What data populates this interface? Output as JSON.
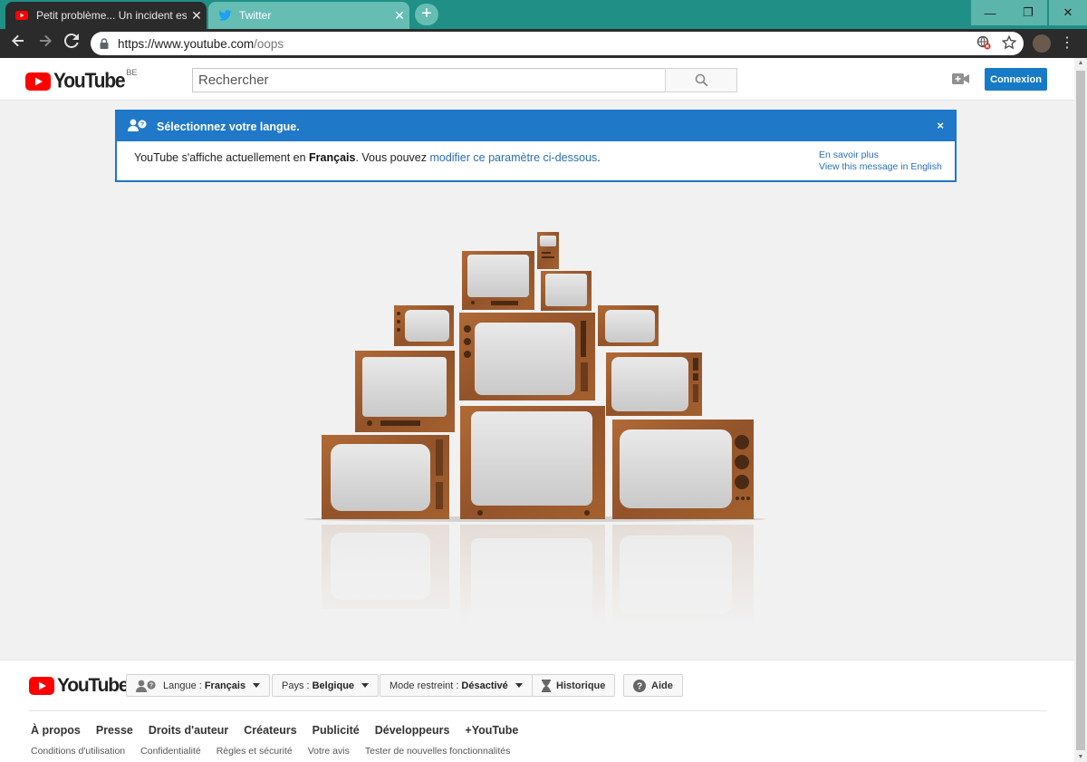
{
  "browser": {
    "tabs": [
      {
        "title": "Petit problème... Un incident est s",
        "active": true
      },
      {
        "title": "Twitter",
        "active": false
      }
    ],
    "close_glyph": "✕",
    "new_tab_glyph": "+",
    "window_controls": {
      "minimize": "—",
      "maximize": "❐",
      "close": "✕"
    },
    "url_domain": "https://www.youtube.com",
    "url_path": "/oops"
  },
  "header": {
    "logo_text": "YouTube",
    "region": "BE",
    "search_placeholder": "Rechercher",
    "signin_label": "Connexion"
  },
  "notice": {
    "title": "Sélectionnez votre langue.",
    "close": "×",
    "body_before": "YouTube s'affiche actuellement en ",
    "language": "Français",
    "body_middle": ". Vous pouvez ",
    "body_link": "modifier ce paramètre ci-dessous",
    "body_after": ".",
    "learn_more": "En savoir plus",
    "view_english": "View this message in English"
  },
  "footer": {
    "logo_text": "YouTube",
    "language": {
      "label": "Langue :",
      "value": "Français"
    },
    "country": {
      "label": "Pays :",
      "value": "Belgique"
    },
    "restricted": {
      "label": "Mode restreint :",
      "value": "Désactivé"
    },
    "history_label": "Historique",
    "help_label": "Aide",
    "primary_links": [
      "À propos",
      "Presse",
      "Droits d'auteur",
      "Créateurs",
      "Publicité",
      "Développeurs",
      "+YouTube"
    ],
    "secondary_links": [
      "Conditions d'utilisation",
      "Confidentialité",
      "Règles et sécurité",
      "Votre avis",
      "Tester de nouvelles fonctionnalités"
    ]
  },
  "colors": {
    "tabstrip": "#208f86",
    "yt_red": "#ff0000",
    "accent_blue": "#167ac6",
    "tv_wood": "#9a5a2c"
  },
  "icons": [
    "youtube-favicon",
    "twitter-favicon",
    "back-arrow-icon",
    "forward-arrow-icon",
    "reload-icon",
    "lock-icon",
    "translate-blocked-icon",
    "star-icon",
    "search-icon",
    "upload-video-icon",
    "users-language-icon",
    "hourglass-icon",
    "help-icon"
  ]
}
